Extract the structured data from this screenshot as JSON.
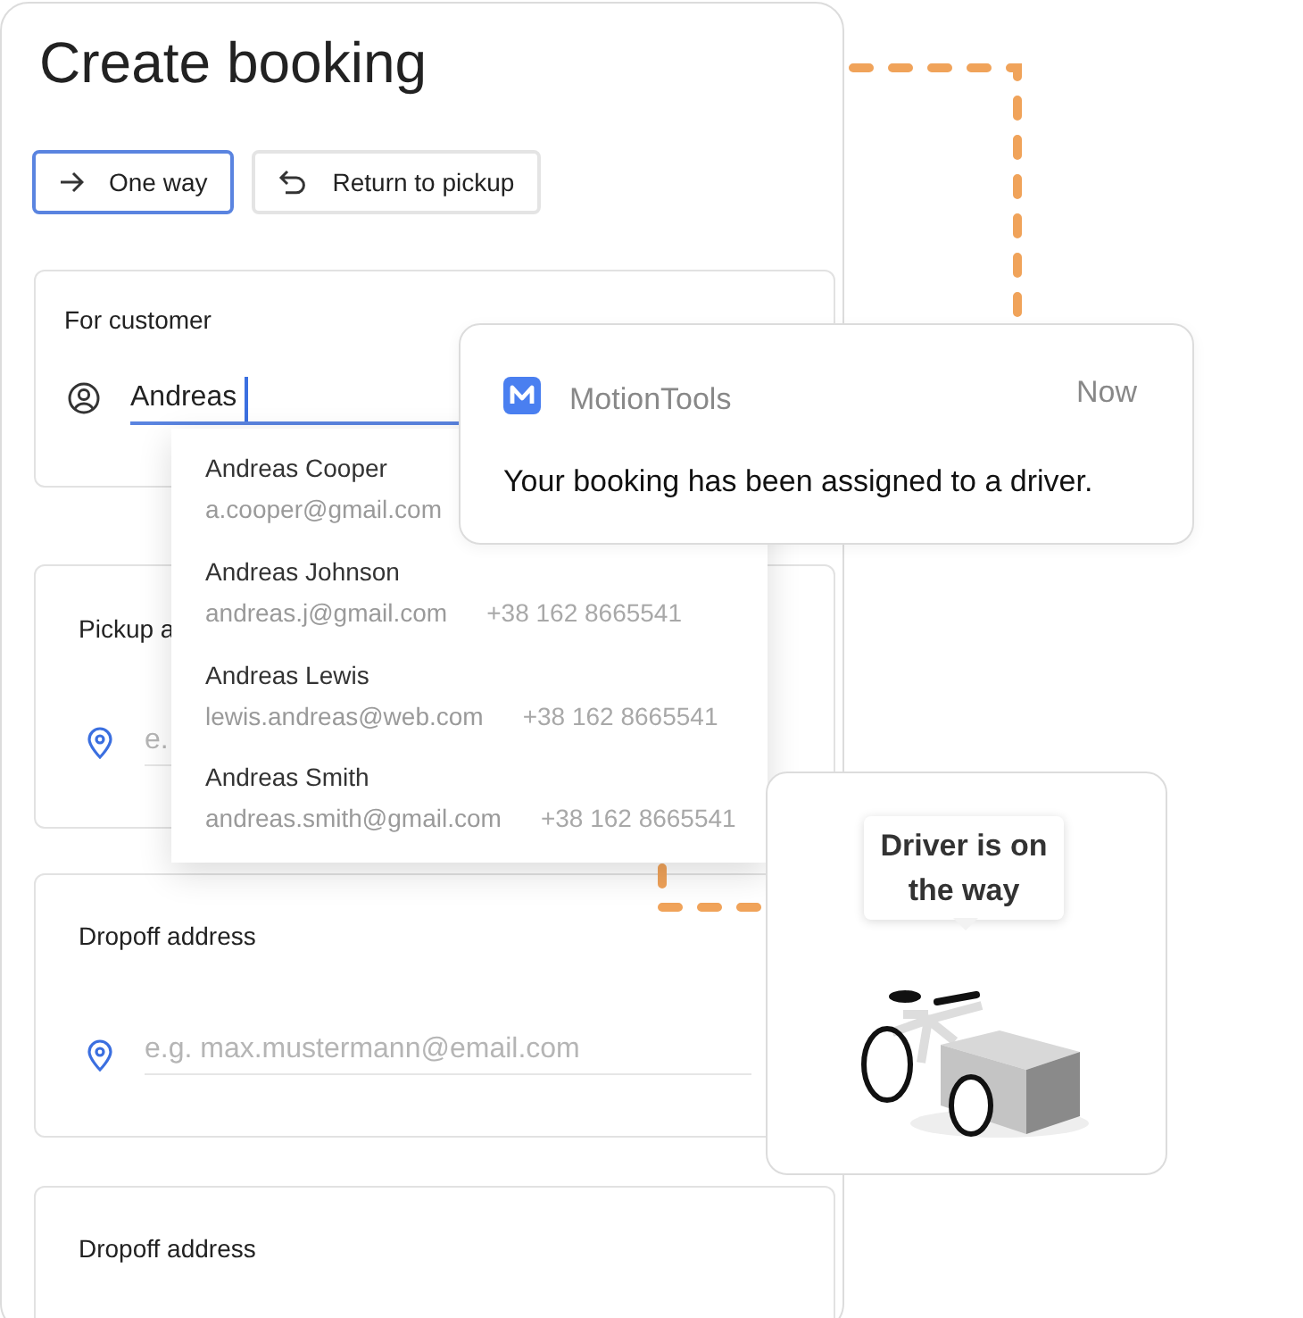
{
  "title": "Create booking",
  "trip_options": [
    {
      "label": "One way",
      "kind": "arrow",
      "selected": true
    },
    {
      "label": "Return to pickup",
      "kind": "return",
      "selected": false
    }
  ],
  "customer": {
    "label": "For customer",
    "value": "Andreas"
  },
  "suggestions": [
    {
      "name": "Andreas Cooper",
      "email": "a.cooper@gmail.com"
    },
    {
      "name": "Andreas Johnson",
      "email": "andreas.j@gmail.com",
      "phone": "+38 162 8665541"
    },
    {
      "name": "Andreas Lewis",
      "email": "lewis.andreas@web.com",
      "phone": "+38 162 8665541"
    },
    {
      "name": "Andreas Smith",
      "email": "andreas.smith@gmail.com",
      "phone": "+38 162 8665541"
    }
  ],
  "pickup": {
    "label": "Pickup a",
    "placeholder": "e."
  },
  "dropoff_sections": [
    {
      "label": "Dropoff address",
      "placeholder": "e.g. max.mustermann@email.com"
    },
    {
      "label": "Dropoff address"
    }
  ],
  "notification": {
    "app": "MotionTools",
    "time": "Now",
    "message": "Your booking has been assigned to a driver."
  },
  "status_card": {
    "bubble": "Driver is on the way"
  }
}
